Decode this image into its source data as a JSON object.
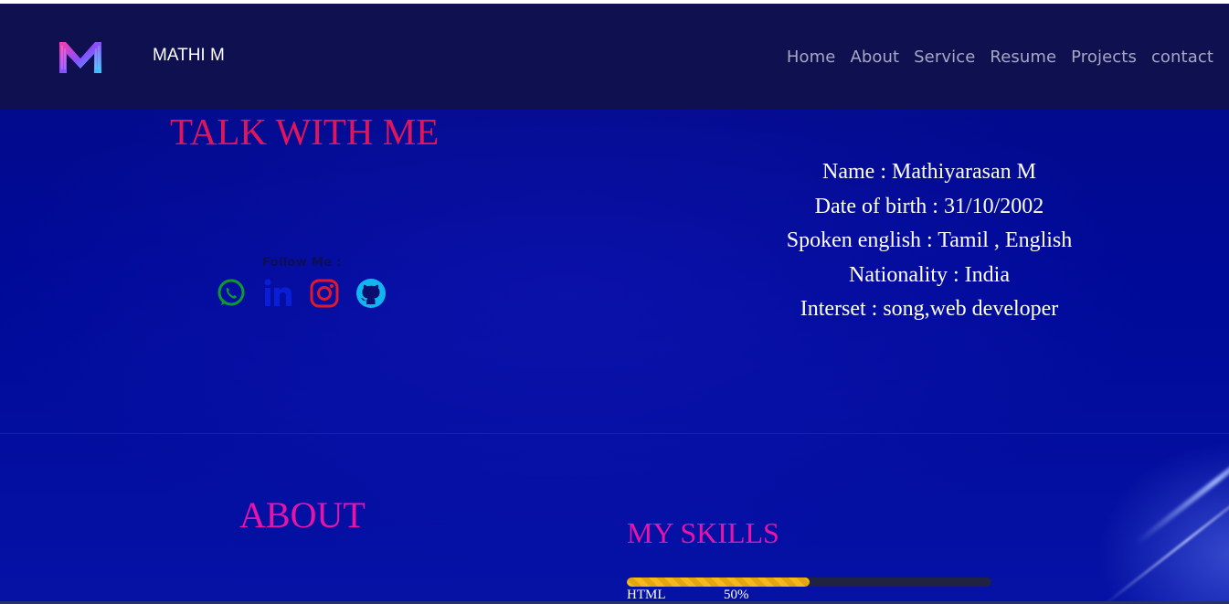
{
  "header": {
    "brand": "MATHI M",
    "logo_letter": "M",
    "nav": [
      "Home",
      "About",
      "Service",
      "Resume",
      "Projects",
      "contact"
    ]
  },
  "talk": {
    "title": "TALK WITH ME",
    "follow_label": "Follow Me :",
    "socials": [
      "whatsapp-icon",
      "linkedin-icon",
      "instagram-icon",
      "github-icon"
    ]
  },
  "info": {
    "lines": [
      "Name : Mathiyarasan M",
      "Date of birth : 31/10/2002",
      "Spoken english : Tamil , English",
      "Nationality : India",
      "Interset : song,web developer"
    ]
  },
  "about": {
    "title": "ABOUT"
  },
  "skills": {
    "title": "MY SKILLS",
    "items": [
      {
        "name": "HTML",
        "percent_label": "50%",
        "level": 0.5
      }
    ]
  },
  "colors": {
    "navbar": "#0e1050",
    "background": "#020a8e",
    "talk_title": "#e0155b",
    "section_title": "#e813a8",
    "nav_link": "#a7a7c4",
    "whatsapp": "#0c9b2c",
    "linkedin": "#0a1ed8",
    "instagram": "#e0182a",
    "github": "#12b5f0",
    "skill_fill": "#f5b91c"
  }
}
